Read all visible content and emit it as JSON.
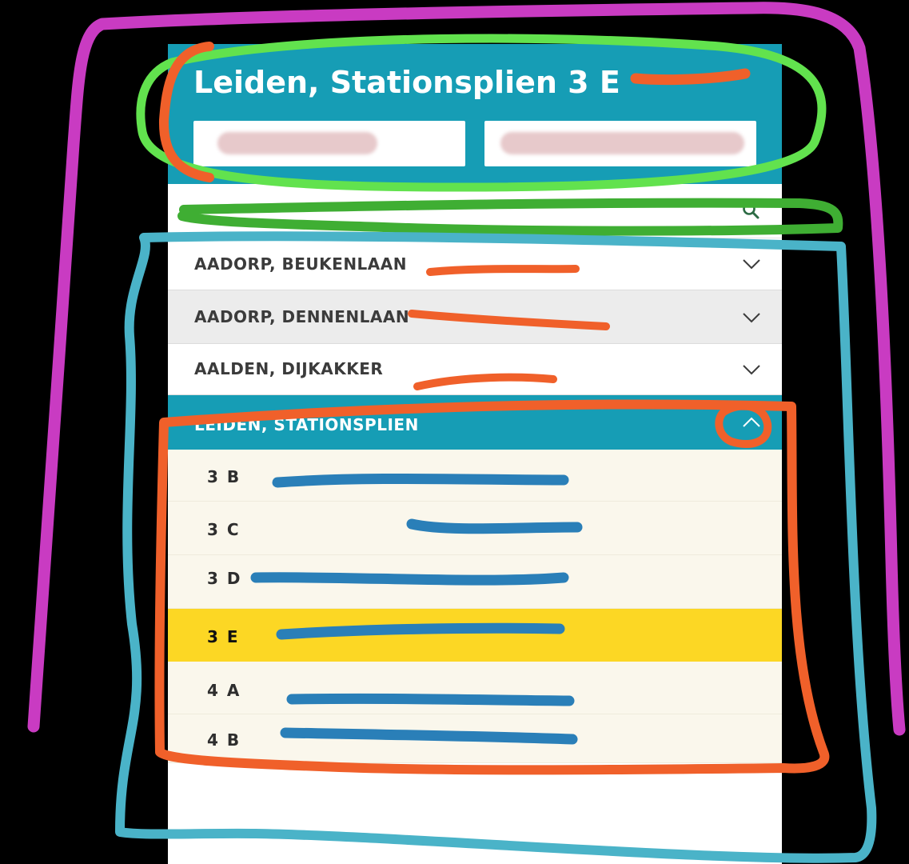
{
  "header": {
    "title": "Leiden, Stationsplien 3 E",
    "background": "#169db5"
  },
  "search": {
    "icon": "search-icon"
  },
  "accordion": {
    "items": [
      {
        "label": "AADORP, BEUKENLAAN",
        "icon": "chevron-down-icon",
        "expanded": false
      },
      {
        "label": "AADORP, DENNENLAAN",
        "icon": "chevron-down-icon",
        "expanded": false,
        "highlighted": true
      },
      {
        "label": "AALDEN, DIJKAKKER",
        "icon": "chevron-down-icon",
        "expanded": false
      },
      {
        "label": "LEIDEN, STATIONSPLIEN",
        "icon": "chevron-up-icon",
        "expanded": true
      }
    ],
    "subitems": [
      {
        "label": "3 B",
        "active": false
      },
      {
        "label": "3 C",
        "active": false
      },
      {
        "label": "3 D",
        "active": false
      },
      {
        "label": "3 E",
        "active": true
      },
      {
        "label": "4 A",
        "active": false
      },
      {
        "label": "4 B",
        "active": false
      }
    ]
  },
  "colors": {
    "accent": "#169db5",
    "active_row": "#fcd724",
    "sub_row_bg": "#faf7ec",
    "annotation_magenta": "#c93bc2",
    "annotation_green_light": "#62e24e",
    "annotation_green_dark": "#3fae33",
    "annotation_orange": "#f0602a",
    "annotation_cyan": "#4ab3c8",
    "annotation_blue": "#2a7fb8"
  }
}
